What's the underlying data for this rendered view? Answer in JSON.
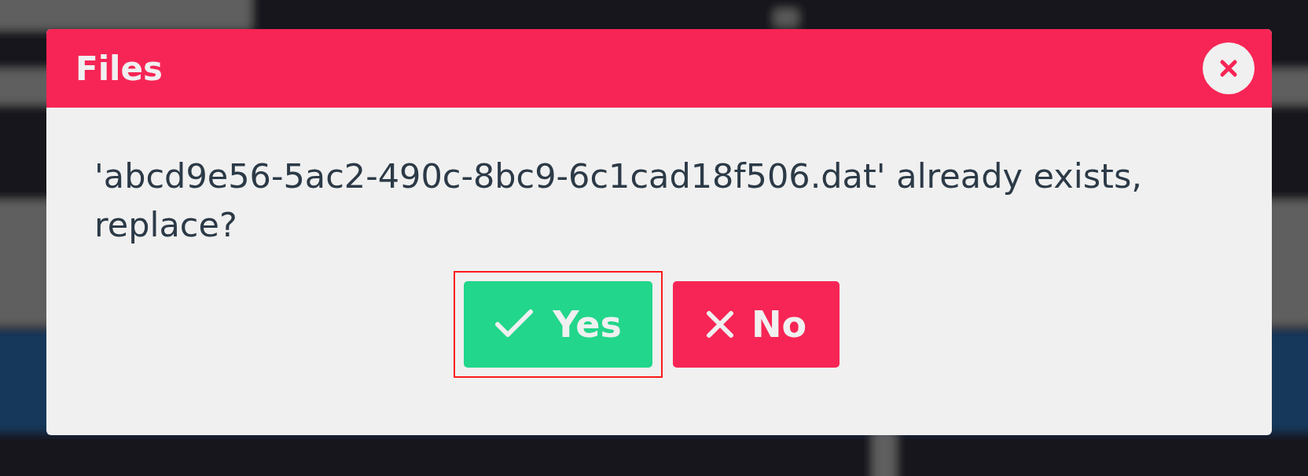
{
  "dialog": {
    "title": "Files",
    "message": "'abcd9e56-5ac2-490c-8bc9-6c1cad18f506.dat' already exists, replace?",
    "buttons": [
      {
        "kind": "confirm",
        "label": "Yes",
        "focused": true
      },
      {
        "kind": "cancel",
        "label": "No",
        "focused": false
      }
    ]
  }
}
